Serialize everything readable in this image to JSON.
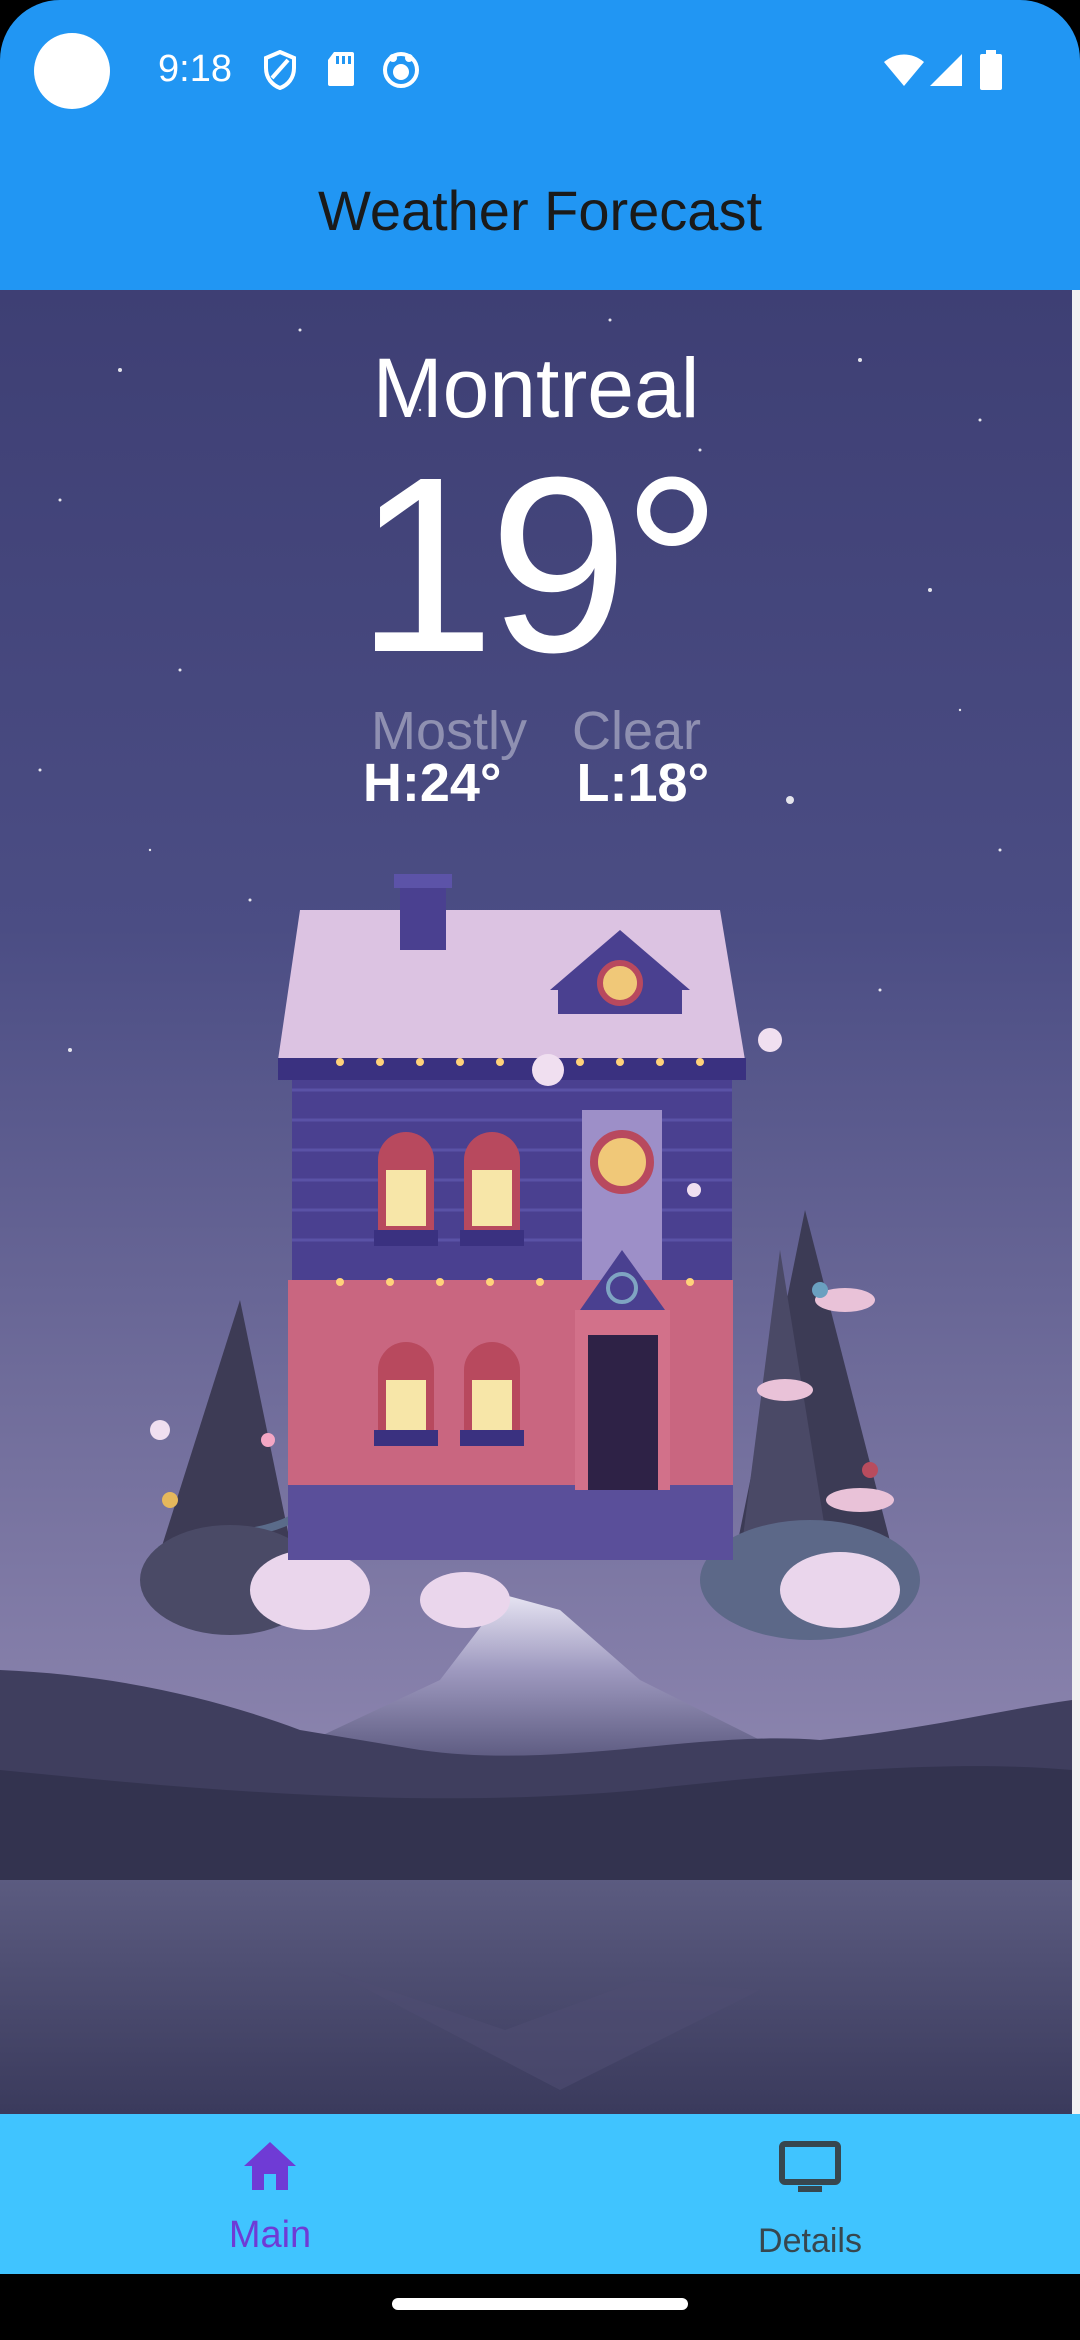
{
  "status_bar": {
    "time": "9:18"
  },
  "app_bar": {
    "title": "Weather Forecast"
  },
  "weather": {
    "city": "Montreal",
    "temperature": "19°",
    "condition": "Mostly Clear",
    "high": "H:24°",
    "low": "L:18°"
  },
  "bottom_nav": {
    "items": [
      {
        "label": "Main",
        "icon": "home-icon",
        "selected": true
      },
      {
        "label": "Details",
        "icon": "monitor-icon",
        "selected": false
      }
    ]
  },
  "colors": {
    "app_bar": "#2196F3",
    "nav_bar": "#40C4FF",
    "nav_selected": "#6F3BD5",
    "nav_unselected": "#37474F"
  }
}
